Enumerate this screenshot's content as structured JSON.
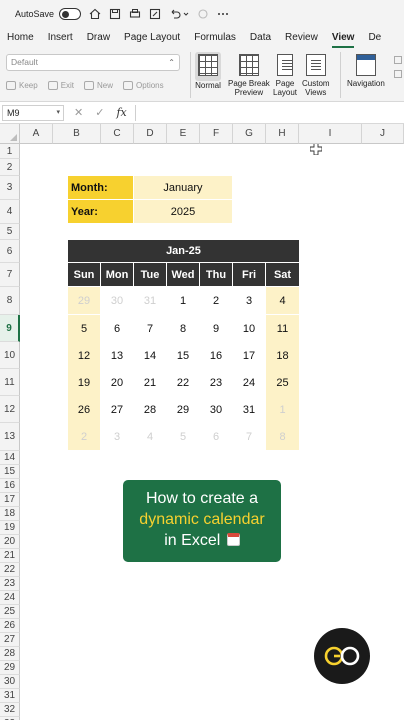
{
  "titlebar": {
    "autosave_label": "AutoSave"
  },
  "tabs": [
    "Home",
    "Insert",
    "Draw",
    "Page Layout",
    "Formulas",
    "Data",
    "Review",
    "View",
    "De"
  ],
  "active_tab": "View",
  "ribbon": {
    "style_select": "Default",
    "small_buttons": [
      "Keep",
      "Exit",
      "New",
      "Options"
    ],
    "views": [
      {
        "label1": "Normal",
        "label2": ""
      },
      {
        "label1": "Page Break",
        "label2": "Preview"
      },
      {
        "label1": "Page",
        "label2": "Layout"
      },
      {
        "label1": "Custom",
        "label2": "Views"
      },
      {
        "label1": "Navigation",
        "label2": ""
      }
    ]
  },
  "formula_bar": {
    "name_box": "M9",
    "fx": "fx",
    "cancel": "✕",
    "confirm": "✓"
  },
  "columns": [
    "A",
    "B",
    "C",
    "D",
    "E",
    "F",
    "G",
    "H",
    "I",
    "J"
  ],
  "rows": [
    "1",
    "2",
    "3",
    "4",
    "5",
    "6",
    "7",
    "8",
    "9",
    "10",
    "11",
    "12",
    "13",
    "14",
    "15",
    "16",
    "17",
    "18",
    "19",
    "20",
    "21",
    "22",
    "23",
    "24",
    "25",
    "26",
    "27",
    "28",
    "29",
    "30",
    "31",
    "32",
    "33"
  ],
  "selected_row": "9",
  "inputs": {
    "month_label": "Month:",
    "month_value": "January",
    "year_label": "Year:",
    "year_value": "2025"
  },
  "calendar": {
    "title": "Jan-25",
    "days": [
      "Sun",
      "Mon",
      "Tue",
      "Wed",
      "Thu",
      "Fri",
      "Sat"
    ],
    "weeks": [
      [
        "29",
        "30",
        "31",
        "1",
        "2",
        "3",
        "4"
      ],
      [
        "5",
        "6",
        "7",
        "8",
        "9",
        "10",
        "11"
      ],
      [
        "12",
        "13",
        "14",
        "15",
        "16",
        "17",
        "18"
      ],
      [
        "19",
        "20",
        "21",
        "22",
        "23",
        "24",
        "25"
      ],
      [
        "26",
        "27",
        "28",
        "29",
        "30",
        "31",
        "1"
      ],
      [
        "2",
        "3",
        "4",
        "5",
        "6",
        "7",
        "8"
      ]
    ],
    "other_month": [
      [
        true,
        true,
        true,
        false,
        false,
        false,
        false
      ],
      [
        false,
        false,
        false,
        false,
        false,
        false,
        false
      ],
      [
        false,
        false,
        false,
        false,
        false,
        false,
        false
      ],
      [
        false,
        false,
        false,
        false,
        false,
        false,
        false
      ],
      [
        false,
        false,
        false,
        false,
        false,
        false,
        true
      ],
      [
        true,
        true,
        true,
        true,
        true,
        true,
        true
      ]
    ]
  },
  "promo": {
    "line1": "How to create a",
    "line2": "dynamic calendar",
    "line3": "in Excel"
  },
  "colors": {
    "accent_green": "#1e7145",
    "highlight_yellow": "#f7d12f",
    "light_yellow": "#fdf2c8",
    "header_dark": "#333333"
  }
}
